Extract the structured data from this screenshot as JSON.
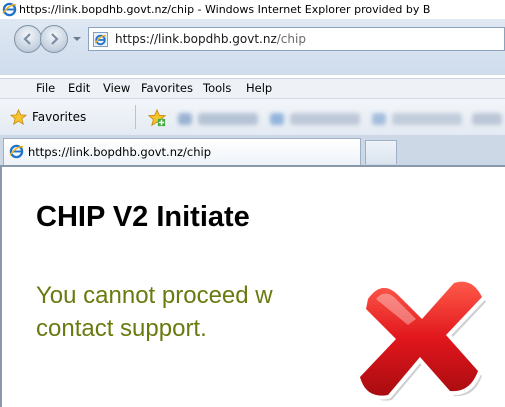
{
  "window": {
    "title": "https://link.bopdhb.govt.nz/chip - Windows Internet Explorer provided by B"
  },
  "address_bar": {
    "url_host": "https://link.bopdhb.govt.nz",
    "url_path": "/chip"
  },
  "menu": {
    "items": [
      "File",
      "Edit",
      "View",
      "Favorites",
      "Tools",
      "Help"
    ]
  },
  "favorites_bar": {
    "favorites_label": "Favorites"
  },
  "tabs": [
    {
      "label": "https://link.bopdhb.govt.nz/chip"
    }
  ],
  "page": {
    "title": "CHIP V2 Initiate",
    "message_line1": "You cannot proceed w",
    "message_line2": "contact support."
  },
  "colors": {
    "message_text": "#6b7a10",
    "error_icon": "#e1161c"
  },
  "icons": {
    "error": "red-x-icon",
    "browser": "ie-logo-icon"
  }
}
